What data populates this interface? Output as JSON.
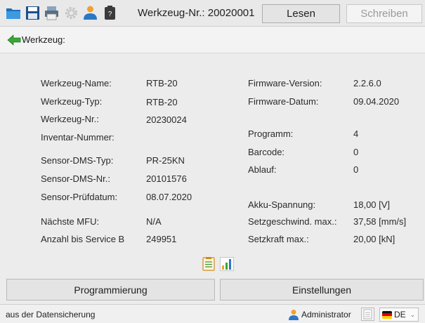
{
  "toolbar": {
    "title": "Werkzeug-Nr.: 20020001",
    "read_label": "Lesen",
    "write_label": "Schreiben"
  },
  "breadcrumb": {
    "label": "Werkzeug:"
  },
  "info": {
    "left": [
      {
        "label": "Werkzeug-Name:",
        "value": "RTB-20"
      },
      {
        "label": "Werkzeug-Typ:",
        "value": "RTB-20"
      },
      {
        "label": "Werkzeug-Nr.:",
        "value": "20230024"
      },
      {
        "label": "Inventar-Nummer:",
        "value": ""
      },
      {
        "label": "Sensor-DMS-Typ:",
        "value": "PR-25KN"
      },
      {
        "label": "Sensor-DMS-Nr.:",
        "value": "20101576"
      },
      {
        "label": "Sensor-Prüfdatum:",
        "value": "08.07.2020"
      },
      {
        "label": "Nächste MFU:",
        "value": "N/A"
      },
      {
        "label": "Anzahl bis Service B",
        "value": "249951"
      }
    ],
    "right": [
      {
        "label": "Firmware-Version:",
        "value": "2.2.6.0"
      },
      {
        "label": "Firmware-Datum:",
        "value": "09.04.2020"
      },
      {
        "label": "Programm:",
        "value": "4"
      },
      {
        "label": "Barcode:",
        "value": "0"
      },
      {
        "label": "Ablauf:",
        "value": "0"
      },
      {
        "label": "Akku-Spannung:",
        "value": "18,00 [V]"
      },
      {
        "label": "Setzgeschwind. max.:",
        "value": "37,58 [mm/s]"
      },
      {
        "label": "Setzkraft max.:",
        "value": "20,00 [kN]"
      }
    ]
  },
  "buttons": {
    "programming": "Programmierung",
    "settings": "Einstellungen"
  },
  "status": {
    "text": "aus der Datensicherung",
    "user": "Administrator",
    "language": "DE"
  },
  "icons": {
    "open": "folder-icon",
    "save": "save-icon",
    "print": "print-icon",
    "config": "gear-icon",
    "user": "user-icon",
    "device": "device-icon",
    "back": "back-arrow-icon",
    "report": "report-icon",
    "chart": "chart-icon"
  },
  "colors": {
    "accent_green": "#3aa635",
    "orange": "#f0a030",
    "blue": "#2b78c5"
  }
}
